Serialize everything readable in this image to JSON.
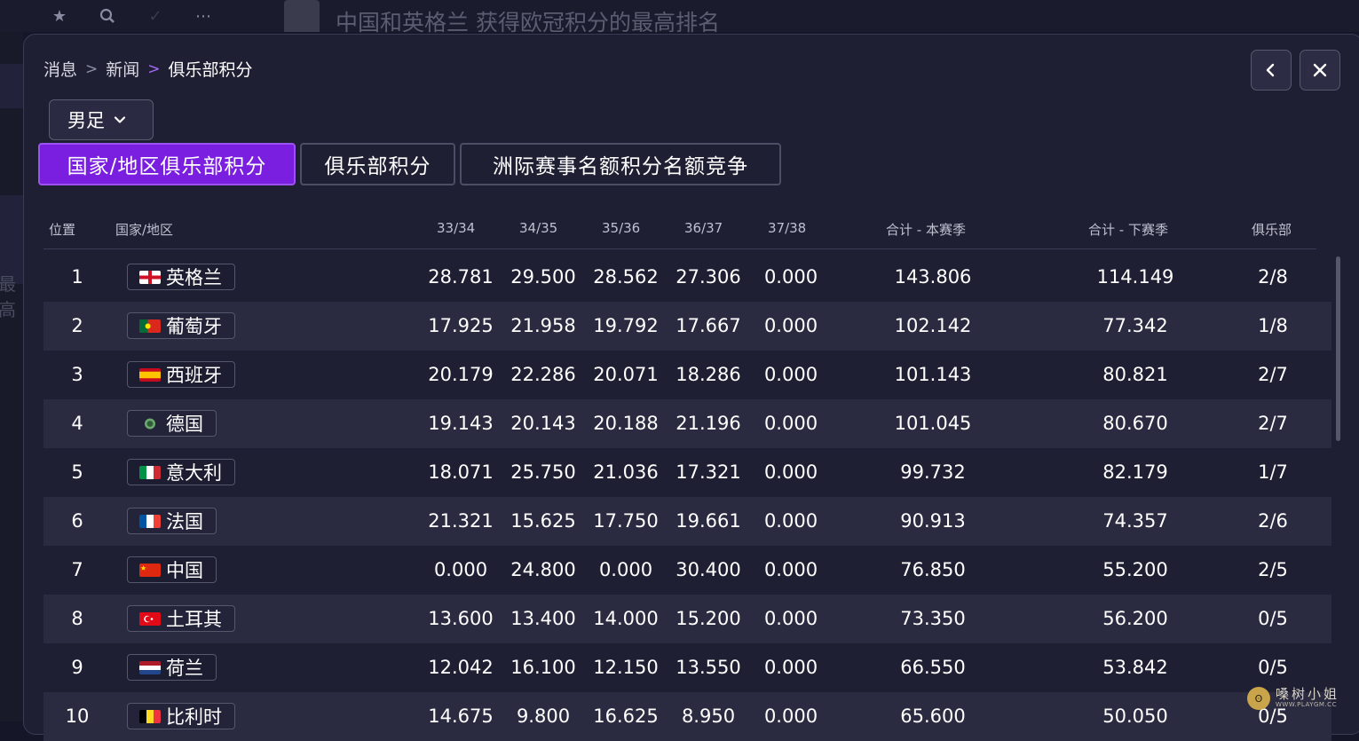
{
  "background": {
    "title": "中国和英格兰 获得欧冠积分的最高排名",
    "side_text": "最高",
    "icons": [
      "star-icon",
      "search-icon",
      "check-icon",
      "more-icon"
    ]
  },
  "breadcrumb": {
    "items": [
      "消息",
      "新闻"
    ],
    "current": "俱乐部积分"
  },
  "nav": {
    "back_icon": "chevron-left-icon",
    "close_icon": "close-icon"
  },
  "dropdown": {
    "selected": "男足"
  },
  "tabs": [
    {
      "label": "国家/地区俱乐部积分",
      "active": true
    },
    {
      "label": "俱乐部积分",
      "active": false
    },
    {
      "label": "洲际赛事名额积分名额竞争",
      "active": false
    }
  ],
  "table": {
    "headers": {
      "rank": "位置",
      "country": "国家/地区",
      "s1": "33/34",
      "s2": "34/35",
      "s3": "35/36",
      "s4": "36/37",
      "s5": "37/38",
      "total_current": "合计 - 本赛季",
      "total_next": "合计 - 下赛季",
      "clubs": "俱乐部"
    },
    "rows": [
      {
        "rank": "1",
        "country": "英格兰",
        "flag": "england",
        "s1": "28.781",
        "s2": "29.500",
        "s3": "28.562",
        "s4": "27.306",
        "s5": "0.000",
        "total_current": "143.806",
        "total_next": "114.149",
        "clubs": "2/8"
      },
      {
        "rank": "2",
        "country": "葡萄牙",
        "flag": "portugal",
        "s1": "17.925",
        "s2": "21.958",
        "s3": "19.792",
        "s4": "17.667",
        "s5": "0.000",
        "total_current": "102.142",
        "total_next": "77.342",
        "clubs": "1/8"
      },
      {
        "rank": "3",
        "country": "西班牙",
        "flag": "spain",
        "s1": "20.179",
        "s2": "22.286",
        "s3": "20.071",
        "s4": "18.286",
        "s5": "0.000",
        "total_current": "101.143",
        "total_next": "80.821",
        "clubs": "2/7"
      },
      {
        "rank": "4",
        "country": "德国",
        "flag": "germany",
        "s1": "19.143",
        "s2": "20.143",
        "s3": "20.188",
        "s4": "21.196",
        "s5": "0.000",
        "total_current": "101.045",
        "total_next": "80.670",
        "clubs": "2/7"
      },
      {
        "rank": "5",
        "country": "意大利",
        "flag": "italy",
        "s1": "18.071",
        "s2": "25.750",
        "s3": "21.036",
        "s4": "17.321",
        "s5": "0.000",
        "total_current": "99.732",
        "total_next": "82.179",
        "clubs": "1/7"
      },
      {
        "rank": "6",
        "country": "法国",
        "flag": "france",
        "s1": "21.321",
        "s2": "15.625",
        "s3": "17.750",
        "s4": "19.661",
        "s5": "0.000",
        "total_current": "90.913",
        "total_next": "74.357",
        "clubs": "2/6"
      },
      {
        "rank": "7",
        "country": "中国",
        "flag": "china",
        "s1": "0.000",
        "s2": "24.800",
        "s3": "0.000",
        "s4": "30.400",
        "s5": "0.000",
        "total_current": "76.850",
        "total_next": "55.200",
        "clubs": "2/5"
      },
      {
        "rank": "8",
        "country": "土耳其",
        "flag": "turkey",
        "s1": "13.600",
        "s2": "13.400",
        "s3": "14.000",
        "s4": "15.200",
        "s5": "0.000",
        "total_current": "73.350",
        "total_next": "56.200",
        "clubs": "0/5"
      },
      {
        "rank": "9",
        "country": "荷兰",
        "flag": "netherlands",
        "s1": "12.042",
        "s2": "16.100",
        "s3": "12.150",
        "s4": "13.550",
        "s5": "0.000",
        "total_current": "66.550",
        "total_next": "53.842",
        "clubs": "0/5"
      },
      {
        "rank": "10",
        "country": "比利时",
        "flag": "belgium",
        "s1": "14.675",
        "s2": "9.800",
        "s3": "16.625",
        "s4": "8.950",
        "s5": "0.000",
        "total_current": "65.600",
        "total_next": "50.050",
        "clubs": "0/5"
      }
    ]
  },
  "watermark": {
    "main": "嗓树小姐",
    "sub": "WWW.PLAYGM.CC"
  },
  "colors": {
    "accent": "#7a1ee0",
    "modal_bg": "#1e1f33",
    "row_alt": "#2a2b40"
  }
}
